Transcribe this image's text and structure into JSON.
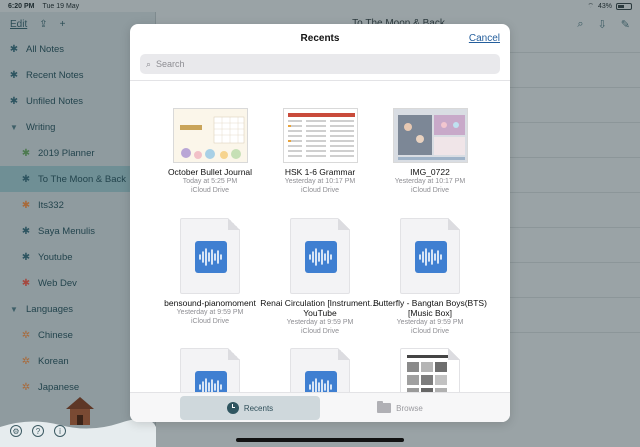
{
  "status_bar": {
    "time": "6:20 PM",
    "date": "Tue 19 May",
    "battery": "43%",
    "battery_level": 0.43
  },
  "sidebar": {
    "edit_label": "Edit",
    "items": [
      {
        "label": "All Notes",
        "icon": "asterisk-icon"
      },
      {
        "label": "Recent Notes",
        "icon": "asterisk-icon"
      },
      {
        "label": "Unfiled Notes",
        "icon": "asterisk-icon"
      },
      {
        "label": "Writing",
        "icon": "disclosure-caret-icon"
      },
      {
        "label": "2019 Planner",
        "icon": "asterisk-icon"
      },
      {
        "label": "To The Moon & Back",
        "icon": "asterisk-icon"
      },
      {
        "label": "Its332",
        "icon": "asterisk-icon"
      },
      {
        "label": "Saya Menulis",
        "icon": "asterisk-icon"
      },
      {
        "label": "Youtube",
        "icon": "asterisk-icon"
      },
      {
        "label": "Web Dev",
        "icon": "asterisk-icon"
      },
      {
        "label": "Languages",
        "icon": "disclosure-caret-icon"
      },
      {
        "label": "Chinese",
        "icon": "gear-icon"
      },
      {
        "label": "Korean",
        "icon": "gear-icon"
      },
      {
        "label": "Japanese",
        "icon": "gear-icon"
      }
    ]
  },
  "main": {
    "title": "To The Moon & Back"
  },
  "modal": {
    "title": "Recents",
    "cancel_label": "Cancel",
    "search_placeholder": "Search",
    "files": [
      {
        "name": "October Bullet Journal",
        "meta1": "Today at 5:25 PM",
        "meta2": "iCloud Drive",
        "kind": "image"
      },
      {
        "name": "HSK 1-6 Grammar",
        "meta1": "Yesterday at 10:17 PM",
        "meta2": "iCloud Drive",
        "kind": "image"
      },
      {
        "name": "IMG_0722",
        "meta1": "Yesterday at 10:17 PM",
        "meta2": "iCloud Drive",
        "kind": "image"
      },
      {
        "name": "bensound-pianomoment",
        "meta1": "Yesterday at 9:59 PM",
        "meta2": "iCloud Drive",
        "kind": "audio"
      },
      {
        "name": "Renai Circulation [Instrument...- YouTube",
        "meta1": "Yesterday at 9:59 PM",
        "meta2": "iCloud Drive",
        "kind": "audio"
      },
      {
        "name": "Butterfly - Bangtan Boys(BTS) [Music Box]",
        "meta1": "Yesterday at 9:59 PM",
        "meta2": "iCloud Drive",
        "kind": "audio"
      },
      {
        "kind": "audio"
      },
      {
        "kind": "audio"
      },
      {
        "kind": "image"
      }
    ],
    "tabs": {
      "recents": "Recents",
      "browse": "Browse"
    }
  },
  "colors": {
    "accent": "#245e9c",
    "selected_row": "#6f8f95",
    "audio_icon": "#3f7fd1"
  }
}
